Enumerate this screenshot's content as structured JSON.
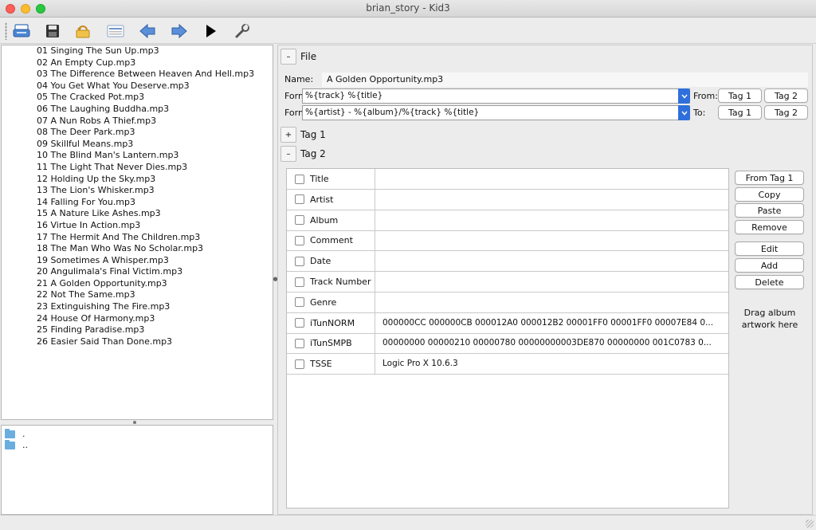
{
  "window": {
    "title": "brian_story - Kid3"
  },
  "toolbar": {
    "buttons": [
      {
        "name": "open-icon"
      },
      {
        "name": "save-icon"
      },
      {
        "name": "revert-icon"
      },
      {
        "name": "filelist-icon"
      },
      {
        "name": "previous-icon"
      },
      {
        "name": "next-icon"
      },
      {
        "name": "play-icon"
      },
      {
        "name": "settings-icon"
      }
    ]
  },
  "files": [
    "01 Singing The Sun Up.mp3",
    "02 An Empty Cup.mp3",
    "03 The Difference Between Heaven And Hell.mp3",
    "04 You Get What You Deserve.mp3",
    "05 The Cracked Pot.mp3",
    "06 The Laughing Buddha.mp3",
    "07 A Nun Robs A Thief.mp3",
    "08 The Deer Park.mp3",
    "09 Skillful Means.mp3",
    "10 The Blind Man's Lantern.mp3",
    "11 The Light That Never Dies.mp3",
    "12 Holding Up the Sky.mp3",
    "13 The Lion's Whisker.mp3",
    "14 Falling For You.mp3",
    "15 A Nature Like Ashes.mp3",
    "16 Virtue In Action.mp3",
    "17 The Hermit And The Children.mp3",
    "18 The Man Who Was No Scholar.mp3",
    "19 Sometimes A Whisper.mp3",
    "20 Angulimala's Final Victim.mp3",
    "21 A Golden Opportunity.mp3",
    "22 Not The Same.mp3",
    "23 Extinguishing The Fire.mp3",
    "24 House Of Harmony.mp3",
    "25 Finding Paradise.mp3",
    "26 Easier Said Than Done.mp3"
  ],
  "dirs": [
    ".",
    ".."
  ],
  "file_section": {
    "toggle": "–",
    "title": "File",
    "name_label": "Name:",
    "name_value": "A Golden Opportunity.mp3",
    "format_up_label": "Format:↑",
    "format_up_value": "%{track} %{title}",
    "format_down_label": "Format:↓",
    "format_down_value": "%{artist} - %{album}/%{track} %{title}",
    "from_label": "From:",
    "to_label": "To:",
    "tag1_label": "Tag 1",
    "tag2_label": "Tag 2"
  },
  "tag1_section": {
    "toggle": "+",
    "title": "Tag 1"
  },
  "tag2_section": {
    "toggle": "–",
    "title": "Tag 2",
    "rows": [
      {
        "name": "Title",
        "value": ""
      },
      {
        "name": "Artist",
        "value": ""
      },
      {
        "name": "Album",
        "value": ""
      },
      {
        "name": "Comment",
        "value": ""
      },
      {
        "name": "Date",
        "value": ""
      },
      {
        "name": "Track Number",
        "value": ""
      },
      {
        "name": "Genre",
        "value": ""
      },
      {
        "name": "iTunNORM",
        "value": "000000CC 000000CB 000012A0 000012B2 00001FF0 00001FF0 00007E84 0..."
      },
      {
        "name": "iTunSMPB",
        "value": "00000000 00000210 00000780 00000000003DE870 00000000 001C0783 0..."
      },
      {
        "name": "TSSE",
        "value": "Logic Pro X 10.6.3"
      }
    ],
    "buttons": {
      "from_tag1": "From Tag 1",
      "copy": "Copy",
      "paste": "Paste",
      "remove": "Remove",
      "edit": "Edit",
      "add": "Add",
      "delete": "Delete"
    },
    "drag_artwork": "Drag album artwork here"
  }
}
